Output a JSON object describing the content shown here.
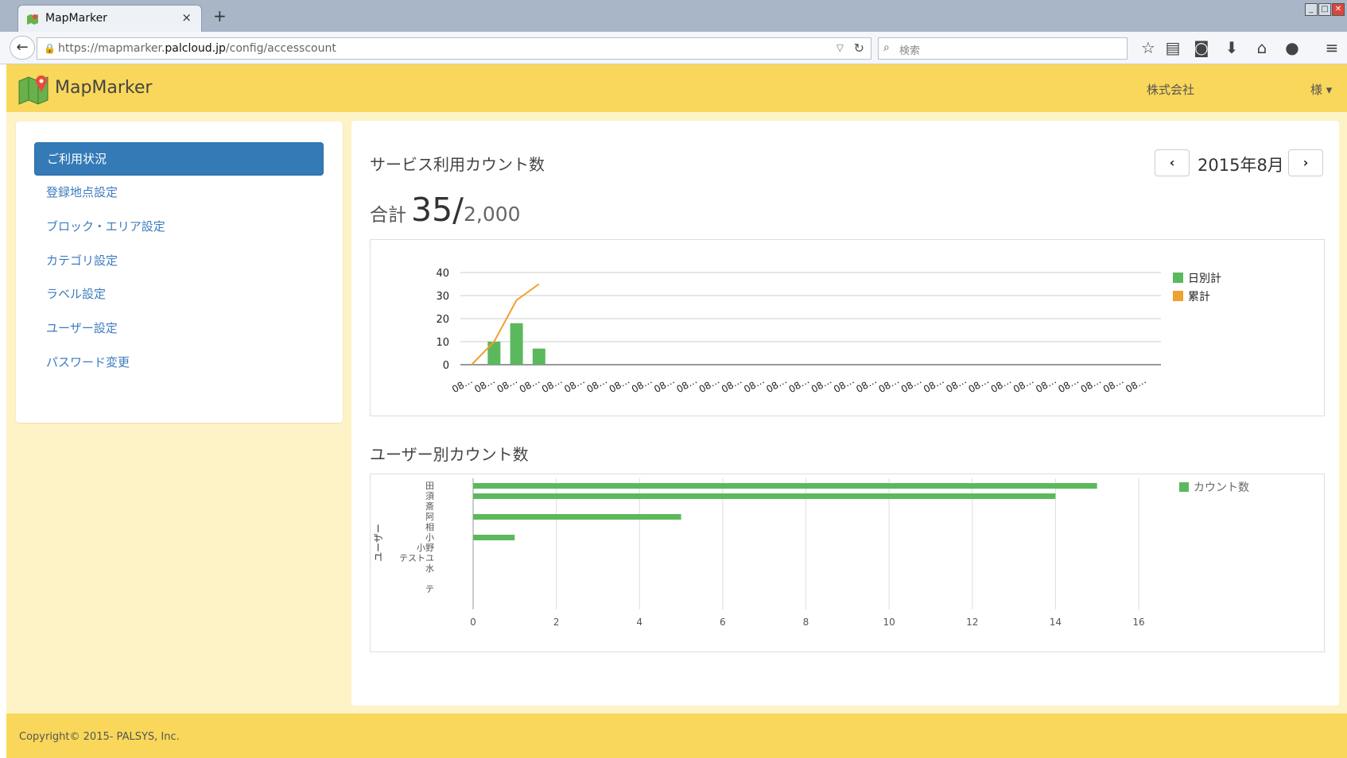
{
  "browser": {
    "tab_title": "MapMarker",
    "tab_close": "×",
    "new_tab": "+",
    "url_prefix": "https://mapmarker.",
    "url_host": "palcloud.jp",
    "url_path": "/config/accesscount",
    "search_placeholder": "検索",
    "toolbar_icons": [
      "star-icon",
      "reader-icon",
      "pocket-icon",
      "download-icon",
      "home-icon",
      "chat-icon",
      "menu-icon"
    ]
  },
  "app": {
    "brand": "MapMarker",
    "company": "株式会社",
    "user_suffix": "様 ▾",
    "accent": "#f9d75a",
    "primary": "#337ab7"
  },
  "sidebar": {
    "items": [
      {
        "label": "ご利用状況",
        "active": true
      },
      {
        "label": "登録地点設定",
        "active": false
      },
      {
        "label": "ブロック・エリア設定",
        "active": false
      },
      {
        "label": "カテゴリ設定",
        "active": false
      },
      {
        "label": "ラベル設定",
        "active": false
      },
      {
        "label": "ユーザー設定",
        "active": false
      },
      {
        "label": "パスワード変更",
        "active": false
      }
    ]
  },
  "main": {
    "title": "サービス利用カウント数",
    "month": "2015年8月",
    "prev": "‹",
    "next": "›",
    "total_label": "合計",
    "total_value": "35/",
    "total_cap": "2,000",
    "user_section_title": "ユーザー別カウント数"
  },
  "chart_data": [
    {
      "type": "bar",
      "categories": [
        "08…",
        "08…",
        "08…",
        "08…",
        "08…",
        "08…",
        "08…",
        "08…",
        "08…",
        "08…",
        "08…",
        "08…",
        "08…",
        "08…",
        "08…",
        "08…",
        "08…",
        "08…",
        "08…",
        "08…",
        "08…",
        "08…",
        "08…",
        "08…",
        "08…",
        "08…",
        "08…",
        "08…",
        "08…",
        "08…",
        "08…"
      ],
      "series": [
        {
          "name": "日別計",
          "kind": "bar",
          "color": "#5cb85c",
          "values": [
            0,
            10,
            18,
            7,
            0,
            0,
            0,
            0,
            0,
            0,
            0,
            0,
            0,
            0,
            0,
            0,
            0,
            0,
            0,
            0,
            0,
            0,
            0,
            0,
            0,
            0,
            0,
            0,
            0,
            0,
            0
          ]
        },
        {
          "name": "累計",
          "kind": "line",
          "color": "#f0a030",
          "values": [
            0,
            10,
            28,
            35
          ]
        }
      ],
      "yticks": [
        "0",
        "10",
        "20",
        "30",
        "40"
      ],
      "ylim": [
        0,
        40
      ],
      "legend": "right"
    },
    {
      "type": "bar",
      "orientation": "horizontal",
      "categories": [
        "田",
        "須",
        "斎",
        "阿",
        "相",
        "小",
        "小野",
        "テストユ",
        "水",
        "",
        "テ"
      ],
      "series": [
        {
          "name": "カウント数",
          "color": "#5cb85c",
          "values": [
            15,
            14,
            0,
            5,
            0,
            1,
            0,
            0,
            0,
            0,
            0
          ]
        }
      ],
      "ylabel": "ユーザー",
      "xticks": [
        "0",
        "2",
        "4",
        "6",
        "8",
        "10",
        "12",
        "14",
        "16"
      ],
      "xlim": [
        0,
        16
      ],
      "legend": "top-right"
    }
  ],
  "footer": {
    "copyright": "Copyright© 2015- PALSYS, Inc."
  }
}
